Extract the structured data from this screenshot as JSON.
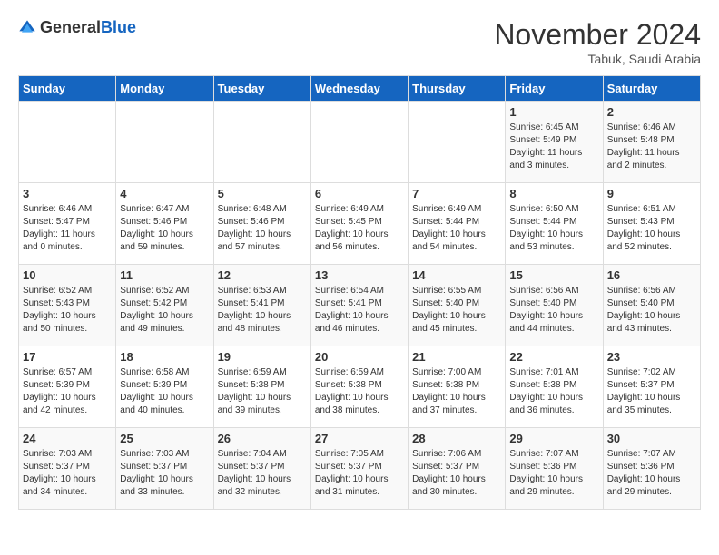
{
  "header": {
    "logo_general": "General",
    "logo_blue": "Blue",
    "month": "November 2024",
    "location": "Tabuk, Saudi Arabia"
  },
  "days_of_week": [
    "Sunday",
    "Monday",
    "Tuesday",
    "Wednesday",
    "Thursday",
    "Friday",
    "Saturday"
  ],
  "weeks": [
    {
      "days": [
        {
          "number": "",
          "sunrise": "",
          "sunset": "",
          "daylight": ""
        },
        {
          "number": "",
          "sunrise": "",
          "sunset": "",
          "daylight": ""
        },
        {
          "number": "",
          "sunrise": "",
          "sunset": "",
          "daylight": ""
        },
        {
          "number": "",
          "sunrise": "",
          "sunset": "",
          "daylight": ""
        },
        {
          "number": "",
          "sunrise": "",
          "sunset": "",
          "daylight": ""
        },
        {
          "number": "1",
          "sunrise": "Sunrise: 6:45 AM",
          "sunset": "Sunset: 5:49 PM",
          "daylight": "Daylight: 11 hours and 3 minutes."
        },
        {
          "number": "2",
          "sunrise": "Sunrise: 6:46 AM",
          "sunset": "Sunset: 5:48 PM",
          "daylight": "Daylight: 11 hours and 2 minutes."
        }
      ]
    },
    {
      "days": [
        {
          "number": "3",
          "sunrise": "Sunrise: 6:46 AM",
          "sunset": "Sunset: 5:47 PM",
          "daylight": "Daylight: 11 hours and 0 minutes."
        },
        {
          "number": "4",
          "sunrise": "Sunrise: 6:47 AM",
          "sunset": "Sunset: 5:46 PM",
          "daylight": "Daylight: 10 hours and 59 minutes."
        },
        {
          "number": "5",
          "sunrise": "Sunrise: 6:48 AM",
          "sunset": "Sunset: 5:46 PM",
          "daylight": "Daylight: 10 hours and 57 minutes."
        },
        {
          "number": "6",
          "sunrise": "Sunrise: 6:49 AM",
          "sunset": "Sunset: 5:45 PM",
          "daylight": "Daylight: 10 hours and 56 minutes."
        },
        {
          "number": "7",
          "sunrise": "Sunrise: 6:49 AM",
          "sunset": "Sunset: 5:44 PM",
          "daylight": "Daylight: 10 hours and 54 minutes."
        },
        {
          "number": "8",
          "sunrise": "Sunrise: 6:50 AM",
          "sunset": "Sunset: 5:44 PM",
          "daylight": "Daylight: 10 hours and 53 minutes."
        },
        {
          "number": "9",
          "sunrise": "Sunrise: 6:51 AM",
          "sunset": "Sunset: 5:43 PM",
          "daylight": "Daylight: 10 hours and 52 minutes."
        }
      ]
    },
    {
      "days": [
        {
          "number": "10",
          "sunrise": "Sunrise: 6:52 AM",
          "sunset": "Sunset: 5:43 PM",
          "daylight": "Daylight: 10 hours and 50 minutes."
        },
        {
          "number": "11",
          "sunrise": "Sunrise: 6:52 AM",
          "sunset": "Sunset: 5:42 PM",
          "daylight": "Daylight: 10 hours and 49 minutes."
        },
        {
          "number": "12",
          "sunrise": "Sunrise: 6:53 AM",
          "sunset": "Sunset: 5:41 PM",
          "daylight": "Daylight: 10 hours and 48 minutes."
        },
        {
          "number": "13",
          "sunrise": "Sunrise: 6:54 AM",
          "sunset": "Sunset: 5:41 PM",
          "daylight": "Daylight: 10 hours and 46 minutes."
        },
        {
          "number": "14",
          "sunrise": "Sunrise: 6:55 AM",
          "sunset": "Sunset: 5:40 PM",
          "daylight": "Daylight: 10 hours and 45 minutes."
        },
        {
          "number": "15",
          "sunrise": "Sunrise: 6:56 AM",
          "sunset": "Sunset: 5:40 PM",
          "daylight": "Daylight: 10 hours and 44 minutes."
        },
        {
          "number": "16",
          "sunrise": "Sunrise: 6:56 AM",
          "sunset": "Sunset: 5:40 PM",
          "daylight": "Daylight: 10 hours and 43 minutes."
        }
      ]
    },
    {
      "days": [
        {
          "number": "17",
          "sunrise": "Sunrise: 6:57 AM",
          "sunset": "Sunset: 5:39 PM",
          "daylight": "Daylight: 10 hours and 42 minutes."
        },
        {
          "number": "18",
          "sunrise": "Sunrise: 6:58 AM",
          "sunset": "Sunset: 5:39 PM",
          "daylight": "Daylight: 10 hours and 40 minutes."
        },
        {
          "number": "19",
          "sunrise": "Sunrise: 6:59 AM",
          "sunset": "Sunset: 5:38 PM",
          "daylight": "Daylight: 10 hours and 39 minutes."
        },
        {
          "number": "20",
          "sunrise": "Sunrise: 6:59 AM",
          "sunset": "Sunset: 5:38 PM",
          "daylight": "Daylight: 10 hours and 38 minutes."
        },
        {
          "number": "21",
          "sunrise": "Sunrise: 7:00 AM",
          "sunset": "Sunset: 5:38 PM",
          "daylight": "Daylight: 10 hours and 37 minutes."
        },
        {
          "number": "22",
          "sunrise": "Sunrise: 7:01 AM",
          "sunset": "Sunset: 5:38 PM",
          "daylight": "Daylight: 10 hours and 36 minutes."
        },
        {
          "number": "23",
          "sunrise": "Sunrise: 7:02 AM",
          "sunset": "Sunset: 5:37 PM",
          "daylight": "Daylight: 10 hours and 35 minutes."
        }
      ]
    },
    {
      "days": [
        {
          "number": "24",
          "sunrise": "Sunrise: 7:03 AM",
          "sunset": "Sunset: 5:37 PM",
          "daylight": "Daylight: 10 hours and 34 minutes."
        },
        {
          "number": "25",
          "sunrise": "Sunrise: 7:03 AM",
          "sunset": "Sunset: 5:37 PM",
          "daylight": "Daylight: 10 hours and 33 minutes."
        },
        {
          "number": "26",
          "sunrise": "Sunrise: 7:04 AM",
          "sunset": "Sunset: 5:37 PM",
          "daylight": "Daylight: 10 hours and 32 minutes."
        },
        {
          "number": "27",
          "sunrise": "Sunrise: 7:05 AM",
          "sunset": "Sunset: 5:37 PM",
          "daylight": "Daylight: 10 hours and 31 minutes."
        },
        {
          "number": "28",
          "sunrise": "Sunrise: 7:06 AM",
          "sunset": "Sunset: 5:37 PM",
          "daylight": "Daylight: 10 hours and 30 minutes."
        },
        {
          "number": "29",
          "sunrise": "Sunrise: 7:07 AM",
          "sunset": "Sunset: 5:36 PM",
          "daylight": "Daylight: 10 hours and 29 minutes."
        },
        {
          "number": "30",
          "sunrise": "Sunrise: 7:07 AM",
          "sunset": "Sunset: 5:36 PM",
          "daylight": "Daylight: 10 hours and 29 minutes."
        }
      ]
    }
  ]
}
